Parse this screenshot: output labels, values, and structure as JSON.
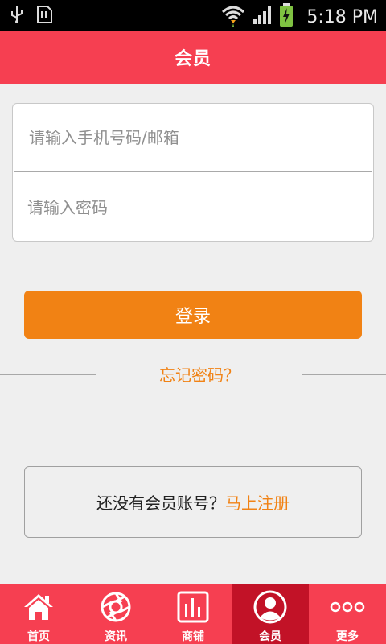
{
  "status_bar": {
    "time": "5:18 PM",
    "icons": [
      "usb-icon",
      "sd-card-icon",
      "wifi-icon",
      "signal-icon",
      "battery-charging-icon"
    ]
  },
  "header": {
    "title": "会员"
  },
  "login_form": {
    "username_placeholder": "请输入手机号码/邮箱",
    "username_value": "",
    "password_placeholder": "请输入密码",
    "password_value": ""
  },
  "login_button_label": "登录",
  "forgot_password_label": "忘记密码？",
  "register": {
    "prompt": "还没有会员账号？",
    "link_label": "马上注册"
  },
  "bottom_nav": {
    "items": [
      {
        "label": "首页",
        "icon": "home-icon",
        "active": false
      },
      {
        "label": "资讯",
        "icon": "aperture-icon",
        "active": false
      },
      {
        "label": "商铺",
        "icon": "shop-chart-icon",
        "active": false
      },
      {
        "label": "会员",
        "icon": "member-avatar-icon",
        "active": true
      },
      {
        "label": "更多",
        "icon": "more-dots-icon",
        "active": false
      }
    ]
  },
  "colors": {
    "brand_red": "#f63f51",
    "active_red": "#c21227",
    "accent_orange": "#f18214"
  }
}
